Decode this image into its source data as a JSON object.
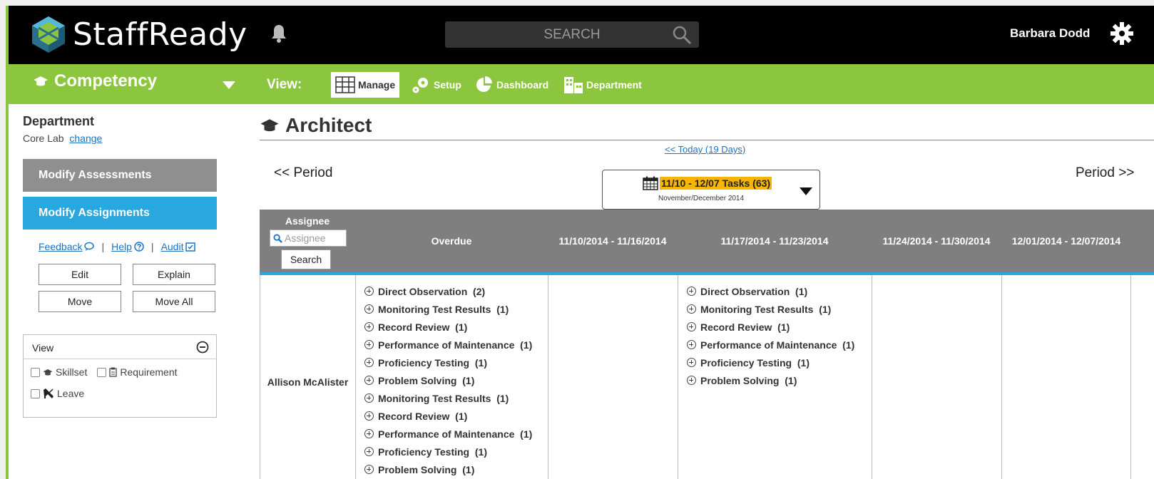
{
  "header": {
    "app_name": "StaffReady",
    "search_placeholder": "SEARCH",
    "user_name": "Barbara Dodd"
  },
  "module_bar": {
    "module_label": "Competency",
    "view_label": "View:",
    "tabs": [
      {
        "label": "Manage",
        "icon": "grid-icon",
        "active": true
      },
      {
        "label": "Setup",
        "icon": "gears-icon",
        "active": false
      },
      {
        "label": "Dashboard",
        "icon": "pie-chart-icon",
        "active": false
      },
      {
        "label": "Department",
        "icon": "building-icon",
        "active": false
      }
    ]
  },
  "sidebar": {
    "department_title": "Department",
    "department_name": "Core Lab",
    "change_link": "change",
    "modify_assessments": "Modify Assessments",
    "modify_assignments": "Modify Assignments",
    "feedback_link": "Feedback",
    "help_link": "Help",
    "audit_link": "Audit",
    "separator": "|",
    "edit_button": "Edit",
    "explain_button": "Explain",
    "move_button": "Move",
    "move_all_button": "Move All",
    "view_panel": {
      "title": "View",
      "options": [
        "Skillset",
        "Requirement",
        "Leave"
      ]
    }
  },
  "main": {
    "title": "Architect",
    "today_link": "<< Today (19 Days)",
    "period_prev": "<< Period",
    "period_next": "Period >>",
    "period_picker": {
      "label": "11/10 - 12/07 Tasks (63)",
      "sub": "November/December 2014"
    },
    "table": {
      "assignee_header": "Assignee",
      "assignee_placeholder": "Assignee",
      "search_button": "Search",
      "columns": [
        "Overdue",
        "11/10/2014 - 11/16/2014",
        "11/17/2014 - 11/23/2014",
        "11/24/2014 - 11/30/2014",
        "12/01/2014 - 12/07/2014"
      ],
      "rows": [
        {
          "assignee": "Allison McAlister",
          "overdue": [
            "Direct Observation  (2)",
            "Monitoring Test Results  (1)",
            "Record Review  (1)",
            "Performance of Maintenance  (1)",
            "Proficiency Testing  (1)",
            "Problem Solving  (1)",
            "Monitoring Test Results  (1)",
            "Record Review  (1)",
            "Performance of Maintenance  (1)",
            "Proficiency Testing  (1)",
            "Problem Solving  (1)"
          ],
          "week2": [
            "Direct Observation  (1)",
            "Monitoring Test Results  (1)",
            "Record Review  (1)",
            "Performance of Maintenance  (1)",
            "Proficiency Testing  (1)",
            "Problem Solving  (1)"
          ]
        }
      ]
    }
  },
  "colors": {
    "top_bar": "#000000",
    "green_bar": "#8cc63f",
    "accent_blue": "#29a8e0",
    "table_header": "#7f7f7f",
    "period_highlight": "#f7b500"
  }
}
